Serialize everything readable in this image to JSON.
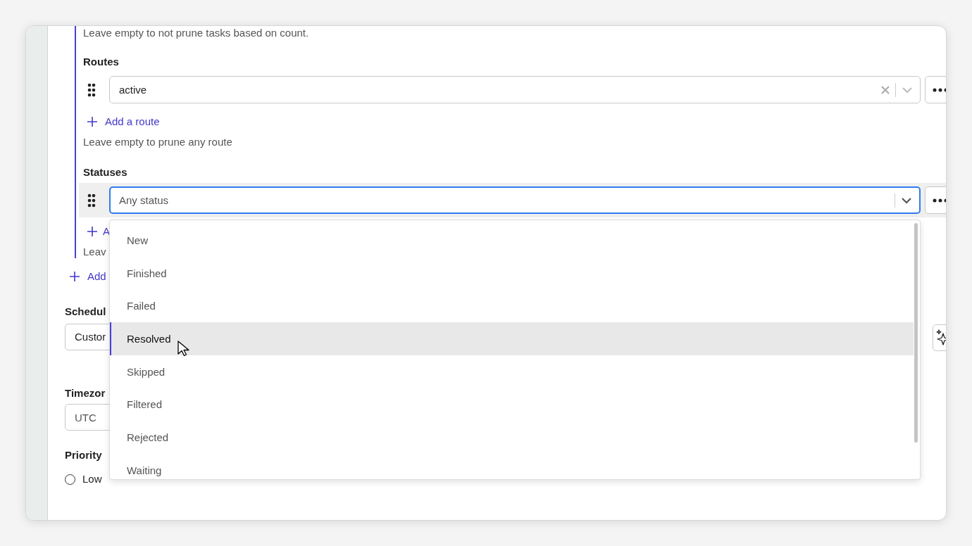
{
  "routes_section": {
    "prune_hint": "Leave empty to not prune tasks based on count.",
    "routes": {
      "label": "Routes",
      "items": [
        {
          "value": "active"
        }
      ],
      "add_link": "Add a route",
      "hint": "Leave empty to prune any route"
    },
    "statuses": {
      "label": "Statuses",
      "field": {
        "placeholder": "Any status",
        "focused": true
      },
      "add_link": "A",
      "hint": "Leav"
    }
  },
  "add_link": "Add",
  "schedule": {
    "label": "Schedul",
    "value": "Custor"
  },
  "timezone": {
    "label": "Timezor",
    "value": "UTC"
  },
  "priority": {
    "label": "Priority",
    "options": [
      {
        "label": "Low",
        "selected": false
      }
    ]
  },
  "dropdown": {
    "options": [
      {
        "label": "New",
        "selected": false
      },
      {
        "label": "Finished",
        "selected": false
      },
      {
        "label": "Failed",
        "selected": false
      },
      {
        "label": "Resolved",
        "selected": true
      },
      {
        "label": "Skipped",
        "selected": false
      },
      {
        "label": "Filtered",
        "selected": false
      },
      {
        "label": "Rejected",
        "selected": false
      },
      {
        "label": "Waiting",
        "selected": false
      }
    ]
  }
}
